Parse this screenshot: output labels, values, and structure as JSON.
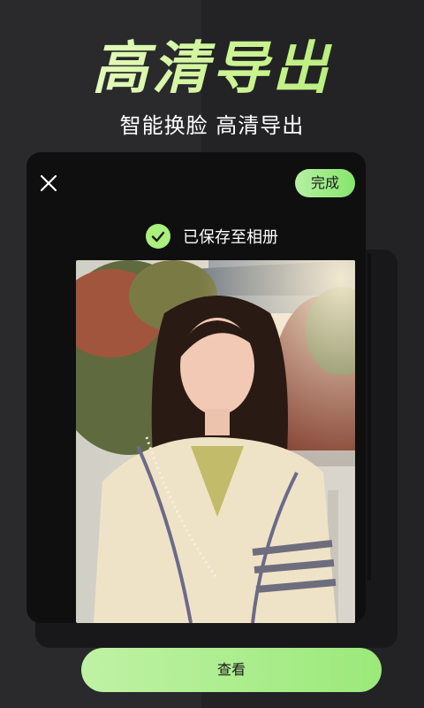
{
  "promo": {
    "headline": "高清导出",
    "subline": "智能换脸 高清导出"
  },
  "dialog": {
    "close_icon": "close-icon",
    "done_label": "完成",
    "saved_message": "已保存至相册",
    "saved_icon": "check-circle-icon",
    "photo_alt": "Portrait of a young woman in a cream cardigan with a pearl necklace outdoors",
    "view_label": "查看"
  },
  "colors": {
    "accent_green": "#a9f07d",
    "card_bg": "#0f0f10",
    "page_bg": "#262629"
  }
}
